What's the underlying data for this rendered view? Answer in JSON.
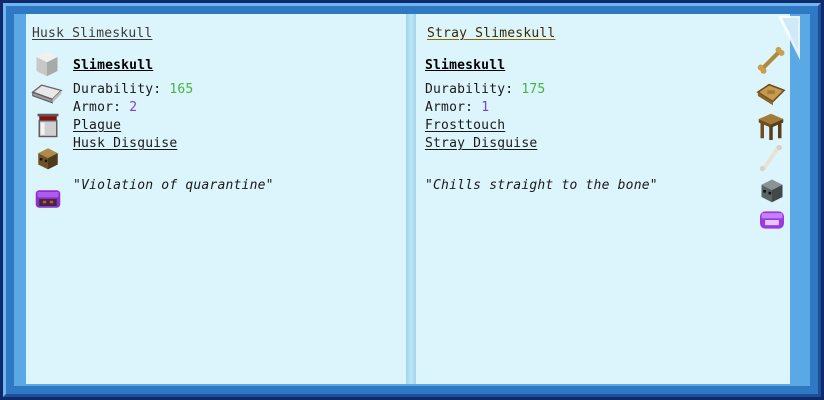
{
  "left": {
    "title": "Husk Slimeskull",
    "item_name": "Slimeskull",
    "durability_label": "Durability:",
    "durability_value": "165",
    "armor_label": "Armor:",
    "armor_value": "2",
    "ability": "Plague",
    "disguise": "Husk Disguise",
    "quote": "\"Violation of quarantine\"",
    "icons": [
      "iron-block-icon",
      "iron-ingot-icon",
      "bucket-icon",
      "husk-head-icon",
      "purple-slime-icon"
    ]
  },
  "right": {
    "title": "Stray Slimeskull",
    "item_name": "Slimeskull",
    "durability_label": "Durability:",
    "durability_value": "175",
    "armor_label": "Armor:",
    "armor_value": "1",
    "ability": "Frosttouch",
    "disguise": "Stray Disguise",
    "quote": "\"Chills straight to the bone\"",
    "icons": [
      "bone-icon",
      "leather-icon",
      "table-icon",
      "bone-stick-icon",
      "stray-head-icon",
      "purple-slime-icon"
    ]
  },
  "colors": {
    "durability": "#3fb83f",
    "armor": "#7b3fd6",
    "page": "#dcf4fb",
    "frame": "#2f78c4"
  }
}
